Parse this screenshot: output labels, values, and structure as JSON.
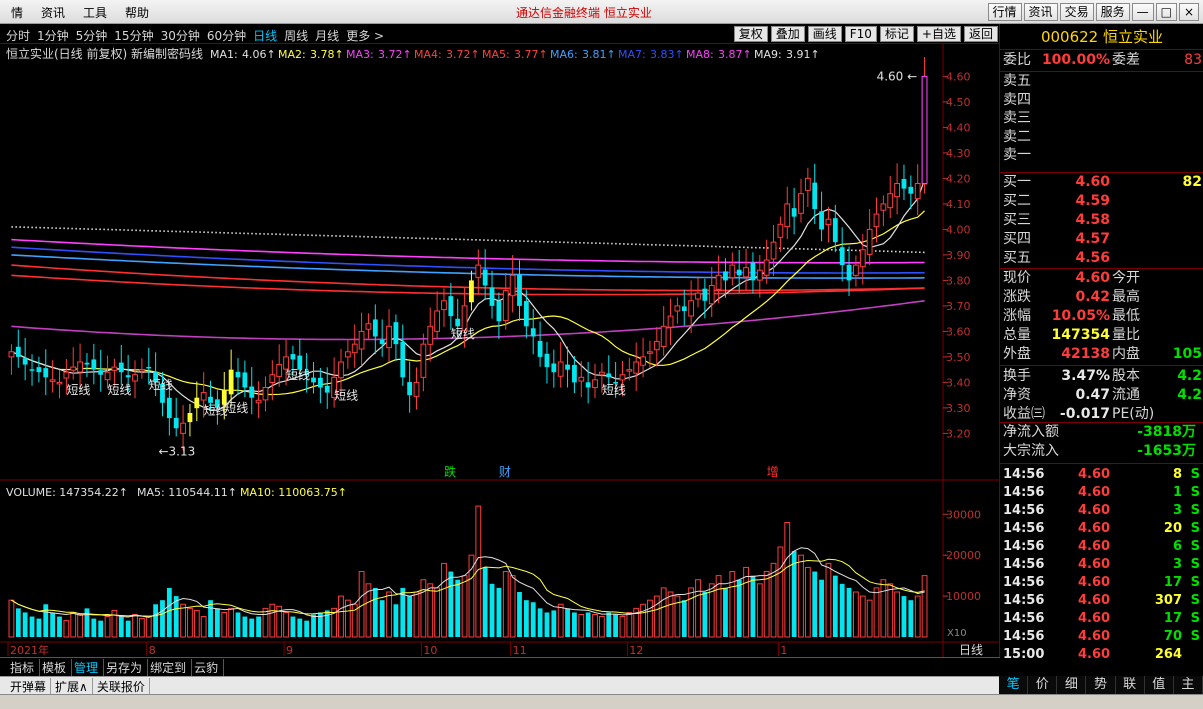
{
  "titlebar": {
    "menu": [
      "情",
      "资讯",
      "工具",
      "帮助"
    ],
    "app_title": "通达信金融终端   恒立实业",
    "right_buttons": [
      "行情",
      "资讯",
      "交易",
      "服务"
    ],
    "win_controls": [
      "—",
      "□",
      "×"
    ]
  },
  "periodbar": {
    "tabs": [
      "分时",
      "1分钟",
      "5分钟",
      "15分钟",
      "30分钟",
      "60分钟",
      "日线",
      "周线",
      "月线",
      "更多 >"
    ],
    "active": "日线",
    "tools": [
      "复权",
      "叠加",
      "画线",
      "F10",
      "标记",
      "+自选",
      "返回"
    ]
  },
  "chart_header": {
    "label": "恒立实业(日线 前复权) 新编制密码线",
    "ma": [
      {
        "name": "MA1:",
        "value": "4.06",
        "color": "#e0e0e0"
      },
      {
        "name": "MA2:",
        "value": "3.78",
        "color": "#ffff40"
      },
      {
        "name": "MA3:",
        "value": "3.72",
        "color": "#ff40ff"
      },
      {
        "name": "MA4:",
        "value": "3.72",
        "color": "#ff4040"
      },
      {
        "name": "MA5:",
        "value": "3.77",
        "color": "#ff4040"
      },
      {
        "name": "MA6:",
        "value": "3.81",
        "color": "#40a0ff"
      },
      {
        "name": "MA7:",
        "value": "3.83",
        "color": "#3050ff"
      },
      {
        "name": "MA8:",
        "value": "3.87",
        "color": "#ff40ff"
      },
      {
        "name": "MA9:",
        "value": "3.91",
        "color": "#e0e0e0"
      }
    ]
  },
  "chart_data": {
    "type": "candlestick",
    "price_axis": {
      "min": 3.13,
      "max": 4.62,
      "ticks": [
        "4.60",
        "4.50",
        "4.40",
        "4.30",
        "4.20",
        "4.10",
        "4.00",
        "3.90",
        "3.80",
        "3.70",
        "3.60",
        "3.50",
        "3.40",
        "3.30",
        "3.20"
      ]
    },
    "high_label": "4.60",
    "low_label": "3.13",
    "annotations": [
      "短线",
      "短线",
      "短线",
      "短线",
      "短线",
      "短线",
      "短线",
      "短线",
      "短线"
    ],
    "event_markers": [
      "跌",
      "财",
      "增"
    ],
    "closes": [
      3.52,
      3.5,
      3.47,
      3.45,
      3.44,
      3.42,
      3.41,
      3.4,
      3.44,
      3.46,
      3.48,
      3.47,
      3.45,
      3.43,
      3.44,
      3.46,
      3.44,
      3.42,
      3.43,
      3.45,
      3.46,
      3.4,
      3.32,
      3.26,
      3.22,
      3.24,
      3.28,
      3.34,
      3.36,
      3.32,
      3.3,
      3.37,
      3.45,
      3.42,
      3.38,
      3.34,
      3.33,
      3.38,
      3.43,
      3.47,
      3.5,
      3.49,
      3.45,
      3.43,
      3.4,
      3.38,
      3.36,
      3.42,
      3.48,
      3.52,
      3.55,
      3.6,
      3.63,
      3.58,
      3.55,
      3.62,
      3.55,
      3.42,
      3.35,
      3.4,
      3.55,
      3.62,
      3.68,
      3.72,
      3.66,
      3.62,
      3.7,
      3.8,
      3.86,
      3.78,
      3.7,
      3.64,
      3.76,
      3.82,
      3.7,
      3.62,
      3.58,
      3.5,
      3.46,
      3.44,
      3.48,
      3.45,
      3.4,
      3.42,
      3.38,
      3.41,
      3.44,
      3.42,
      3.4,
      3.43,
      3.45,
      3.48,
      3.5,
      3.52,
      3.56,
      3.62,
      3.66,
      3.7,
      3.68,
      3.72,
      3.75,
      3.72,
      3.78,
      3.82,
      3.8,
      3.86,
      3.82,
      3.85,
      3.8,
      3.84,
      3.88,
      3.95,
      4.02,
      4.1,
      4.05,
      4.14,
      4.2,
      4.08,
      4.0,
      4.04,
      3.95,
      3.86,
      3.8,
      3.86,
      3.92,
      4.0,
      4.06,
      4.1,
      4.14,
      4.18,
      4.16,
      4.14,
      4.18,
      4.6
    ],
    "volume_axis": {
      "ticks": [
        "30000",
        "20000",
        "10000"
      ],
      "unit": "X10"
    },
    "volume_header": {
      "label": "VOLUME: 147354.22",
      "ma5": "MA5: 110544.11",
      "ma10": "MA10: 110063.75"
    },
    "volumes": [
      9000,
      7000,
      6000,
      5000,
      4500,
      8000,
      6000,
      5000,
      4000,
      6000,
      5500,
      7000,
      4500,
      4000,
      5000,
      6500,
      5000,
      4000,
      5500,
      4500,
      5000,
      8000,
      9000,
      12000,
      10000,
      8000,
      7000,
      6500,
      5000,
      9000,
      7000,
      6000,
      7000,
      6000,
      5000,
      4500,
      5000,
      7000,
      8000,
      7500,
      6000,
      5000,
      4500,
      4000,
      5500,
      6000,
      6500,
      7000,
      10000,
      9000,
      8000,
      16000,
      13000,
      12000,
      9000,
      11000,
      8000,
      12000,
      10000,
      11000,
      14000,
      13000,
      12000,
      18000,
      16000,
      14000,
      15000,
      20000,
      32000,
      17000,
      13000,
      12000,
      16000,
      15000,
      11000,
      9000,
      8500,
      7000,
      6000,
      6500,
      8000,
      7000,
      6000,
      5500,
      6000,
      5500,
      5000,
      6000,
      5500,
      5000,
      6000,
      7000,
      8000,
      9000,
      10000,
      12000,
      11000,
      10000,
      9000,
      12000,
      14000,
      11000,
      13000,
      15000,
      12000,
      16000,
      14000,
      17000,
      15000,
      13000,
      16000,
      18000,
      22000,
      28000,
      21000,
      20000,
      17000,
      16000,
      14000,
      18000,
      15000,
      13000,
      12000,
      11000,
      10000,
      9000,
      12000,
      14000,
      13000,
      11000,
      10000,
      9000,
      10000,
      15000
    ],
    "date_labels": [
      "2021年",
      "8",
      "9",
      "10",
      "11",
      "12",
      "1"
    ],
    "unit_label": "日线"
  },
  "rightpanel": {
    "code": "000622",
    "name": "恒立实业",
    "weibi": {
      "label": "委比",
      "value": "100.00%",
      "label2": "委差",
      "value2": "83"
    },
    "sell": [
      "卖五",
      "卖四",
      "卖三",
      "卖二",
      "卖一"
    ],
    "buy": [
      {
        "label": "买一",
        "price": "4.60",
        "vol": "82"
      },
      {
        "label": "买二",
        "price": "4.59",
        "vol": ""
      },
      {
        "label": "买三",
        "price": "4.58",
        "vol": ""
      },
      {
        "label": "买四",
        "price": "4.57",
        "vol": ""
      },
      {
        "label": "买五",
        "price": "4.56",
        "vol": ""
      }
    ],
    "stats": [
      {
        "a": "现价",
        "b": "4.60",
        "bc": "red",
        "c": "今开",
        "d": ""
      },
      {
        "a": "涨跌",
        "b": "0.42",
        "bc": "red",
        "c": "最高",
        "d": ""
      },
      {
        "a": "涨幅",
        "b": "10.05%",
        "bc": "red",
        "c": "最低",
        "d": ""
      },
      {
        "a": "总量",
        "b": "147354",
        "bc": "yel",
        "c": "量比",
        "d": ""
      },
      {
        "a": "外盘",
        "b": "42138",
        "bc": "red",
        "c": "内盘",
        "d": "105"
      },
      {
        "a": "换手",
        "b": "3.47%",
        "bc": "white",
        "c": "股本",
        "d": "4.2"
      },
      {
        "a": "净资",
        "b": "0.47",
        "bc": "white",
        "c": "流通",
        "d": "4.2"
      },
      {
        "a": "收益㈢",
        "b": "-0.017",
        "bc": "white",
        "c": "PE(动)",
        "d": ""
      }
    ],
    "flow": [
      {
        "label": "净流入额",
        "value": "-3818万"
      },
      {
        "label": "大宗流入",
        "value": "-1653万"
      }
    ],
    "trades": [
      {
        "t": "14:56",
        "p": "4.60",
        "v": "8",
        "s": "S"
      },
      {
        "t": "14:56",
        "p": "4.60",
        "v": "1",
        "s": "S"
      },
      {
        "t": "14:56",
        "p": "4.60",
        "v": "3",
        "s": "S"
      },
      {
        "t": "14:56",
        "p": "4.60",
        "v": "20",
        "s": "S"
      },
      {
        "t": "14:56",
        "p": "4.60",
        "v": "6",
        "s": "S"
      },
      {
        "t": "14:56",
        "p": "4.60",
        "v": "3",
        "s": "S"
      },
      {
        "t": "14:56",
        "p": "4.60",
        "v": "17",
        "s": "S"
      },
      {
        "t": "14:56",
        "p": "4.60",
        "v": "307",
        "s": "S"
      },
      {
        "t": "14:56",
        "p": "4.60",
        "v": "17",
        "s": "S"
      },
      {
        "t": "14:56",
        "p": "4.60",
        "v": "70",
        "s": "S"
      },
      {
        "t": "15:00",
        "p": "4.60",
        "v": "264",
        "s": ""
      }
    ],
    "tabs": [
      "笔",
      "价",
      "细",
      "势",
      "联",
      "值",
      "主"
    ]
  },
  "bottombar1": {
    "tabs": [
      "指标",
      "模板",
      "管理",
      "另存为",
      "绑定到",
      "云豹"
    ],
    "active": "管理"
  },
  "bottombar2": {
    "tabs": [
      "开弹幕",
      "扩展∧",
      "关联报价"
    ]
  },
  "colors": {
    "up": "#ff3c3c",
    "down": "#00e5ee",
    "bg": "#000000",
    "grid": "#7a0000"
  }
}
